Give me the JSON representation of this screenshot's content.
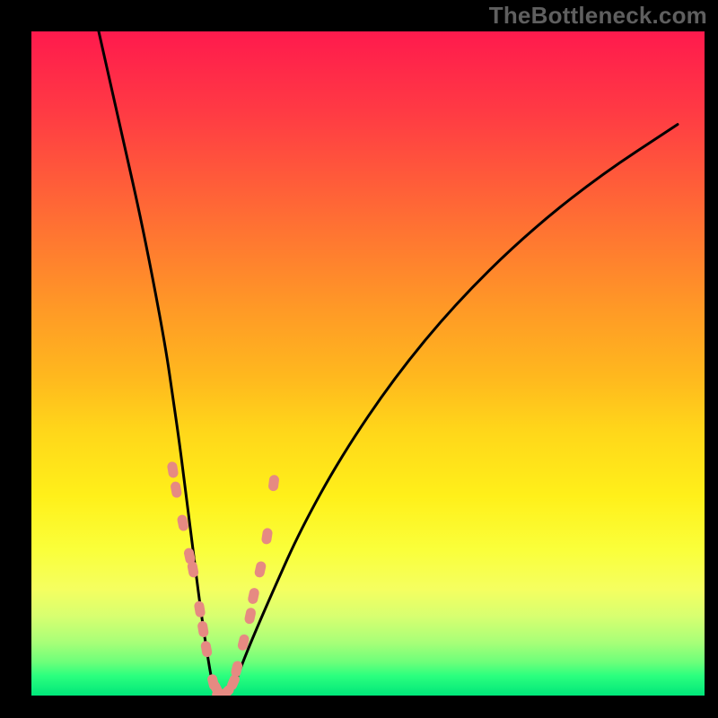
{
  "watermark": "TheBottleneck.com",
  "chart_data": {
    "type": "line",
    "title": "",
    "xlabel": "",
    "ylabel": "",
    "xlim": [
      0,
      100
    ],
    "ylim": [
      0,
      100
    ],
    "series": [
      {
        "name": "curve",
        "note": "V-shaped bottleneck curve",
        "x": [
          10,
          12,
          14,
          16,
          18,
          20,
          21,
          22,
          23,
          24,
          25,
          26,
          27,
          28,
          29,
          30,
          31,
          33,
          36,
          40,
          46,
          54,
          63,
          73,
          84,
          96
        ],
        "y": [
          100,
          91,
          82,
          73,
          63,
          52,
          45,
          38,
          30,
          22,
          14,
          7,
          1,
          0,
          0,
          1,
          4,
          9,
          16,
          25,
          36,
          48,
          59,
          69,
          78,
          86
        ]
      },
      {
        "name": "markers",
        "note": "salmon capsule markers clustered near the V branches (estimated y from gradient position)",
        "x": [
          21.0,
          21.5,
          22.5,
          23.5,
          24.0,
          25.0,
          25.5,
          26.0,
          27.0,
          27.5,
          28.0,
          29.0,
          30.0,
          30.5,
          31.5,
          32.5,
          33.0,
          34.0,
          35.0,
          36.0
        ],
        "y": [
          34.0,
          31.0,
          26.0,
          21.0,
          19.0,
          13.0,
          10.0,
          7.0,
          2.0,
          1.0,
          0.0,
          0.5,
          2.0,
          4.0,
          8.0,
          12.0,
          15.0,
          19.0,
          24.0,
          32.0
        ]
      }
    ],
    "background_gradient": {
      "top": "#ff1a4d",
      "mid": "#fff01a",
      "bottom": "#00e67a"
    },
    "curve_color": "#000000",
    "marker_color": "#e68a82"
  }
}
